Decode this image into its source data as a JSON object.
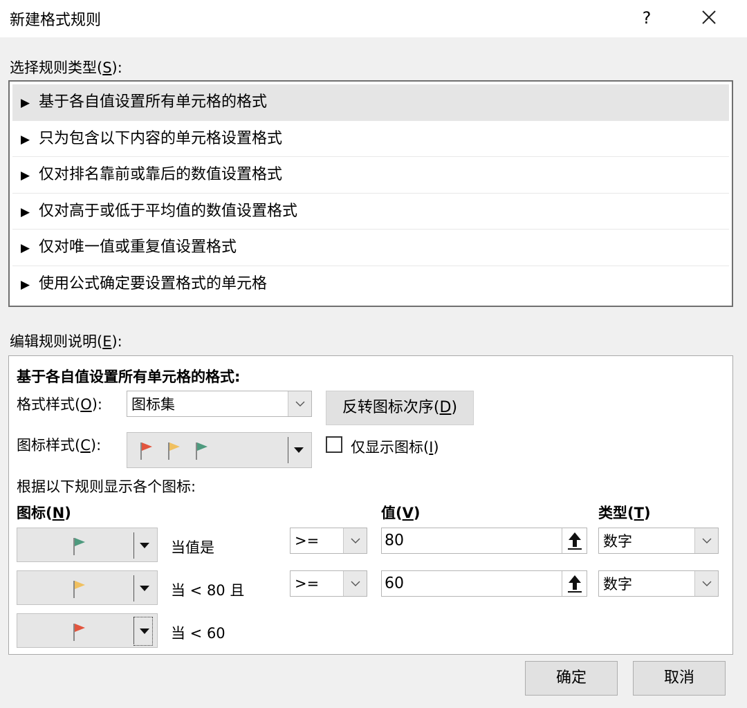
{
  "window": {
    "title": "新建格式规则",
    "help_label": "?",
    "close_label": "close"
  },
  "rule_type": {
    "label_prefix": "选择规则类型(",
    "label_key": "S",
    "label_suffix": "):",
    "items": [
      {
        "label": "基于各自值设置所有单元格的格式",
        "selected": true
      },
      {
        "label": "只为包含以下内容的单元格设置格式",
        "selected": false
      },
      {
        "label": "仅对排名靠前或靠后的数值设置格式",
        "selected": false
      },
      {
        "label": "仅对高于或低于平均值的数值设置格式",
        "selected": false
      },
      {
        "label": "仅对唯一值或重复值设置格式",
        "selected": false
      },
      {
        "label": "使用公式确定要设置格式的单元格",
        "selected": false
      }
    ],
    "arrow_glyph": "▶"
  },
  "edit": {
    "label_prefix": "编辑规则说明(",
    "label_key": "E",
    "label_suffix": "):",
    "heading": "基于各自值设置所有单元格的格式:",
    "format_style": {
      "label_prefix": "格式样式(",
      "label_key": "O",
      "label_suffix": "):",
      "value": "图标集"
    },
    "reverse_button": {
      "prefix": "反转图标次序(",
      "key": "D",
      "suffix": ")"
    },
    "icon_style": {
      "label_prefix": "图标样式(",
      "label_key": "C",
      "label_suffix": "):"
    },
    "show_icon_only": {
      "label_prefix": "仅显示图标(",
      "label_key": "I",
      "label_suffix": ")",
      "checked": false
    },
    "rules_caption": "根据以下规则显示各个图标:",
    "col_icon": {
      "prefix": "图标(",
      "key": "N",
      "suffix": ")"
    },
    "col_value": {
      "prefix": "值(",
      "key": "V",
      "suffix": ")"
    },
    "col_type": {
      "prefix": "类型(",
      "key": "T",
      "suffix": ")"
    },
    "rows": [
      {
        "flag_color": "#4e9a7e",
        "condition": "当值是",
        "operator": ">=",
        "value": "80",
        "type": "数字"
      },
      {
        "flag_color": "#f0c060",
        "condition": "当 < 80 且",
        "operator": ">=",
        "value": "60",
        "type": "数字"
      },
      {
        "flag_color": "#e2553e",
        "condition": "当 < 60"
      }
    ]
  },
  "footer": {
    "ok": "确定",
    "cancel": "取消"
  },
  "colors": {
    "flag_red": "#e2553e",
    "flag_yellow": "#f0c060",
    "flag_green": "#4e9a7e"
  }
}
